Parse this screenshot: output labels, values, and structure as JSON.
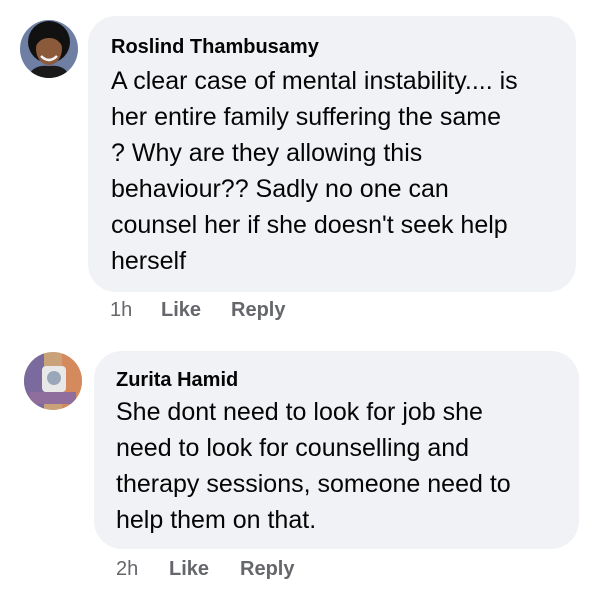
{
  "comments": [
    {
      "author": "Roslind Thambusamy",
      "lines": [
        "A clear case of mental instability.... is",
        "her entire family suffering the same",
        "? Why are they allowing this",
        "behaviour?? Sadly no one can",
        "counsel her if she doesn't seek help",
        "herself"
      ],
      "time": "1h",
      "like_label": "Like",
      "reply_label": "Reply"
    },
    {
      "author": "Zurita Hamid",
      "lines": [
        "She dont need to look for job she",
        "need to look for counselling and",
        "therapy sessions, someone need to",
        "help them on that."
      ],
      "time": "2h",
      "like_label": "Like",
      "reply_label": "Reply"
    }
  ],
  "colors": {
    "bubble_bg": "#f0f2f5",
    "text_primary": "#050505",
    "text_secondary": "#65676b"
  }
}
